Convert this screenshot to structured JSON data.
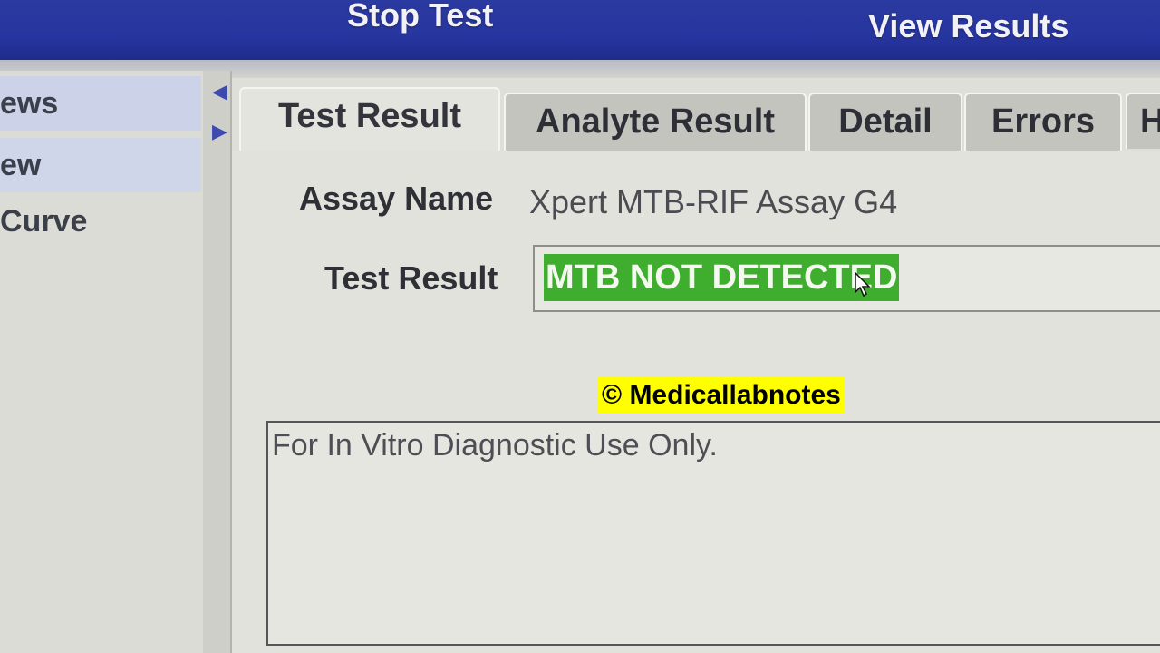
{
  "toolbar": {
    "stop_test_label": "Stop Test",
    "view_results_label": "View Results"
  },
  "sidebar": {
    "items": [
      {
        "label": "ews"
      },
      {
        "label": "ew"
      },
      {
        "label": "Curve"
      }
    ]
  },
  "tabs": [
    {
      "label": "Test Result"
    },
    {
      "label": "Analyte Result"
    },
    {
      "label": "Detail"
    },
    {
      "label": "Errors"
    },
    {
      "label": "H"
    }
  ],
  "test_result": {
    "assay_name_label": "Assay Name",
    "assay_name_value": "Xpert MTB-RIF Assay G4",
    "test_result_label": "Test Result",
    "test_result_value": "MTB NOT DETECTED",
    "notes": "For In Vitro Diagnostic Use Only."
  },
  "watermark": "© Medicallabnotes",
  "colors": {
    "toolbar": "#2735a0",
    "result_highlight": "#3fae2e",
    "watermark_bg": "#ffff00"
  }
}
